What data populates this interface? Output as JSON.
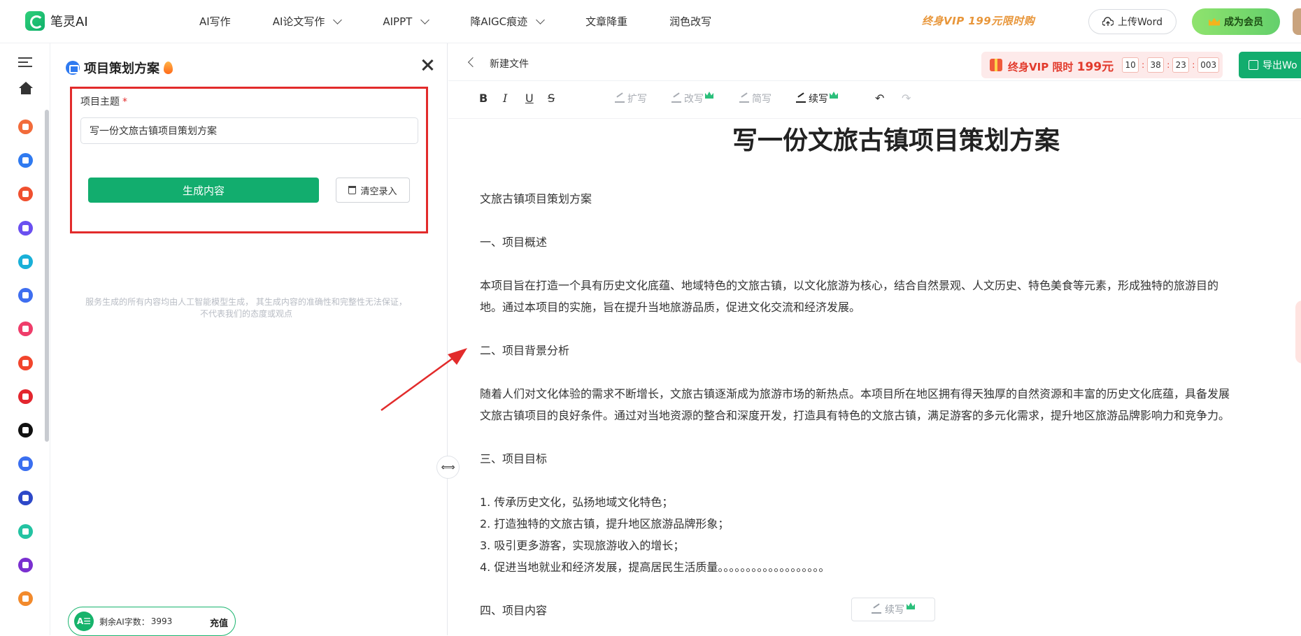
{
  "app": {
    "name": "笔灵AI"
  },
  "nav": {
    "items": [
      "AI写作",
      "AI论文写作",
      "AIPPT",
      "降AIGC痕迹",
      "文章降重",
      "润色改写"
    ]
  },
  "header": {
    "vip_promo": "终身VIP 199元限时购",
    "upload_label": "上传Word",
    "member_label": "成为会员"
  },
  "panel": {
    "title": "项目策划方案",
    "field_label": "项目主题",
    "required_mark": "*",
    "topic_value": "写一份文旅古镇项目策划方案",
    "generate_label": "生成内容",
    "clear_label": "清空录入",
    "disclaimer_line1": "服务生成的所有内容均由人工智能模型生成， 其生成内容的准确性和完整性无法保证，",
    "disclaimer_line2": "不代表我们的态度或观点",
    "quota_badge": "A☰",
    "quota_label": "剩余AI字数：",
    "quota_value": "3993",
    "recharge_label": "充值"
  },
  "editor": {
    "doc_name": "新建文件",
    "vip_label": "终身VIP 限时",
    "vip_price": "199元",
    "timer": [
      "10",
      "38",
      "23",
      "003"
    ],
    "export_label": "导出Wo",
    "toolbar": {
      "bold": "B",
      "italic": "I",
      "underline": "U",
      "strike": "S",
      "expand": "扩写",
      "rewrite": "改写",
      "simplify": "简写",
      "continue": "续写",
      "undo": "↶",
      "redo": "↷"
    },
    "title": "写一份文旅古镇项目策划方案",
    "lines": [
      "文旅古镇项目策划方案",
      "一、项目概述",
      "本项目旨在打造一个具有历史文化底蕴、地域特色的文旅古镇，以文化旅游为核心，结合自然景观、人文历史、特色美食等元素，形成独特的旅游目的",
      "地。通过本项目的实施，旨在提升当地旅游品质，促进文化交流和经济发展。",
      "二、项目背景分析",
      "随着人们对文化体验的需求不断增长，文旅古镇逐渐成为旅游市场的新热点。本项目所在地区拥有得天独厚的自然资源和丰富的历史文化底蕴，具备发展",
      "文旅古镇项目的良好条件。通过对当地资源的整合和深度开发，打造具有特色的文旅古镇，满足游客的多元化需求，提升地区旅游品牌影响力和竞争力。",
      "三、项目目标",
      "1. 传承历史文化，弘扬地域文化特色；",
      "2. 打造独特的文旅古镇，提升地区旅游品牌形象；",
      "3. 吸引更多游客，实现旅游收入的增长；",
      "4. 促进当地就业和经济发展，提高居民生活质量。。。。。。。。。。。。。。。。。。。",
      "四、项目内容"
    ],
    "floating_continue": "续写"
  },
  "colors": {
    "accent": "#12ad6e",
    "highlight_box": "#e22b2b",
    "vip_red": "#e23a2c"
  }
}
